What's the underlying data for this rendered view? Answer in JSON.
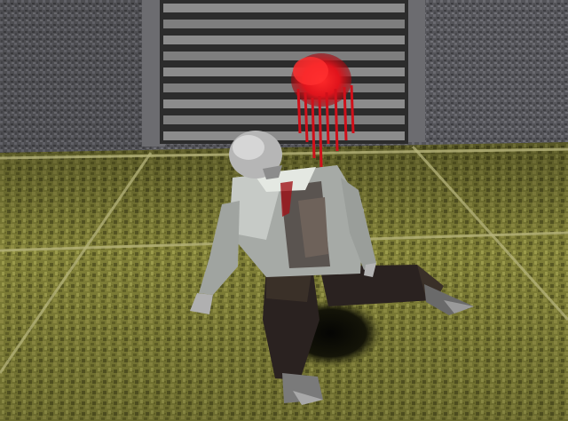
{
  "scene": {
    "kind": "first-person 3D game viewport",
    "hud_text": []
  },
  "colors": {
    "wall_stone": "#5a5a5e",
    "wall_stone_dark": "#3c3c40",
    "shutter_light": "#8a8a8a",
    "shutter_dark": "#2c2c2c",
    "floor_olive": "#8c8a3a",
    "floor_olive_dark": "#5c5c24",
    "floor_grout": "#b4b47a",
    "shirt_gray": "#a6aaa6",
    "shirt_light": "#c8ccc8",
    "pants_dark": "#2a2220",
    "skin_gray": "#b8b8b8",
    "blood_red": "#e0141c",
    "shadow": "#141408"
  },
  "icons": {
    "character": "fallen-npc-icon",
    "blood": "blood-spray-icon"
  }
}
